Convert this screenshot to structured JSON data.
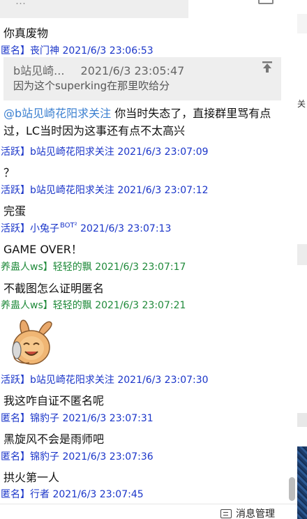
{
  "top_partial": {
    "ghost_text": "…"
  },
  "messages_top": {
    "msg1": "你真废物"
  },
  "meta1": {
    "user": "匿名】丧门神",
    "time": "2021/6/3 23:06:53"
  },
  "quote": {
    "author": "b站见崎...",
    "time": "2021/6/3 23:05:47",
    "body": "因为这个superking在那里吹给分"
  },
  "mention_msg": {
    "mention": "@b站见崎花阳求关注",
    "text": " 你当时失态了，直接群里骂有点过，LC当时因为这事还有点不太高兴"
  },
  "rows": [
    {
      "user": "活跃】b站见崎花阳求关注",
      "time": "2021/6/3 23:07:09",
      "msg": "？"
    },
    {
      "user": "活跃】b站见崎花阳求关注",
      "time": "2021/6/3 23:07:12",
      "msg": "完蛋"
    },
    {
      "user": "活跃】小兔子",
      "badge": "BOT²",
      "time": "2021/6/3 23:07:13",
      "msg": "GAME OVER！"
    },
    {
      "user": "养蛊人ws】轻轻的飘",
      "time": "2021/6/3 23:07:17",
      "msg": "不截图怎么证明匿名"
    },
    {
      "user": "养蛊人ws】轻轻的飘",
      "time": "2021/6/3 23:07:21"
    },
    {
      "user": "活跃】b站见崎花阳求关注",
      "time": "2021/6/3 23:07:30",
      "msg": "我这咋自证不匿名呢"
    },
    {
      "user": "匿名】锦豹子",
      "time": "2021/6/3 23:07:31",
      "msg": "黑旋风不会是雨师吧"
    },
    {
      "user": "匿名】锦豹子",
      "time": "2021/6/3 23:07:36",
      "msg": "拱火第一人"
    },
    {
      "user": "匿名】行者",
      "time": "2021/6/3 23:07:45"
    }
  ],
  "right_bg": {
    "text": "关"
  },
  "bottom_bar": {
    "manage_label": "消息管理",
    "icon": "message-manage-icon"
  },
  "colors": {
    "blue_name": "#1a35c9",
    "green_name": "#1f8a3a",
    "mention": "#3a7fd0"
  }
}
